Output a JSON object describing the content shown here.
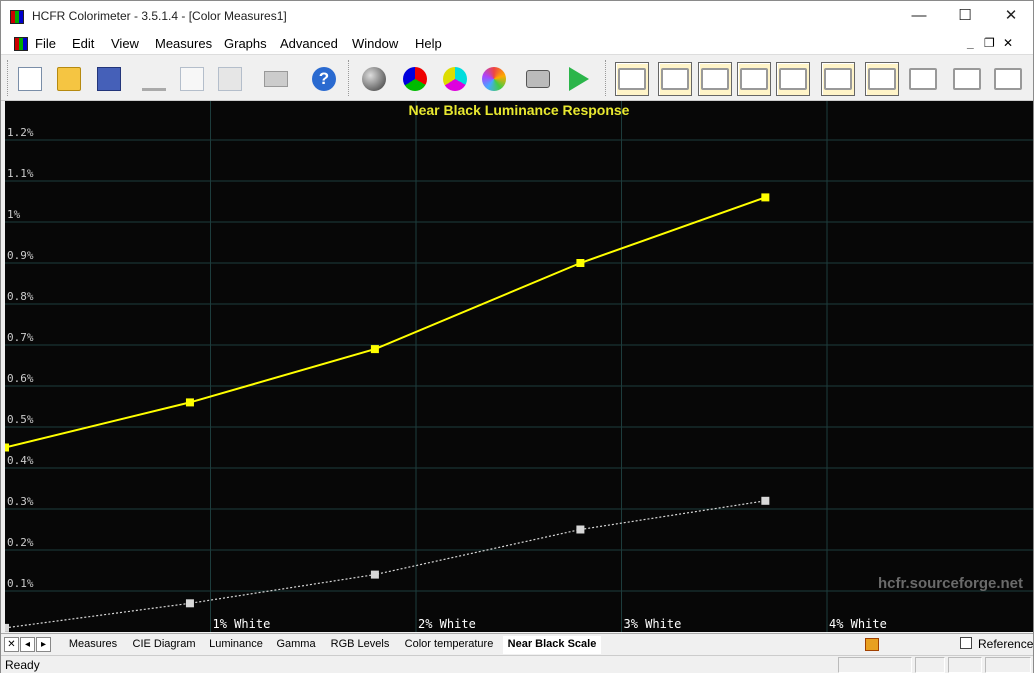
{
  "window": {
    "title": "HCFR Colorimeter - 3.5.1.4 - [Color Measures1]",
    "minimize": "—",
    "maximize": "☐",
    "close": "✕"
  },
  "menu": {
    "items": [
      "File",
      "Edit",
      "View",
      "Measures",
      "Graphs",
      "Advanced",
      "Window",
      "Help"
    ],
    "mdi_min": "_",
    "mdi_restore": "❐",
    "mdi_close": "✕"
  },
  "toolbar": {
    "icons": [
      "new-file-icon",
      "open-folder-icon",
      "save-icon",
      "cut-icon",
      "copy-icon",
      "paste-icon",
      "print-icon",
      "help-icon",
      "measure-grayscale-icon",
      "measure-primaries-icon",
      "measure-secondaries-icon",
      "measure-saturations-icon",
      "camera-icon",
      "play-icon",
      "graph-measures-icon",
      "graph-gamma-icon",
      "graph-luminance-icon",
      "graph-rgb-icon",
      "graph-colortemp-icon",
      "graph-cie-icon",
      "graph-nearblack-icon",
      "graph-nearwhite-icon",
      "graph-saturation-icon",
      "graph-sat-luminance-icon",
      "graph-sat-shift-icon"
    ],
    "help_glyph": "?"
  },
  "chart_data": {
    "type": "line",
    "title": "Near Black Luminance Response",
    "x": [
      0,
      0.9,
      1.8,
      2.8,
      3.7
    ],
    "x_ticks": [
      {
        "value": 1,
        "label": "1% White"
      },
      {
        "value": 2,
        "label": "2% White"
      },
      {
        "value": 3,
        "label": "3% White"
      },
      {
        "value": 4,
        "label": "4% White"
      }
    ],
    "xlim": [
      0,
      5
    ],
    "ylim": [
      0,
      1.3
    ],
    "y_ticks": [
      {
        "value": 0.1,
        "label": "0.1%"
      },
      {
        "value": 0.2,
        "label": "0.2%"
      },
      {
        "value": 0.3,
        "label": "0.3%"
      },
      {
        "value": 0.4,
        "label": "0.4%"
      },
      {
        "value": 0.5,
        "label": "0.5%"
      },
      {
        "value": 0.6,
        "label": "0.6%"
      },
      {
        "value": 0.7,
        "label": "0.7%"
      },
      {
        "value": 0.8,
        "label": "0.8%"
      },
      {
        "value": 0.9,
        "label": "0.9%"
      },
      {
        "value": 1.0,
        "label": "1%"
      },
      {
        "value": 1.1,
        "label": "1.1%"
      },
      {
        "value": 1.2,
        "label": "1.2%"
      }
    ],
    "series": [
      {
        "color": "#ffff00",
        "style": "solid",
        "values": [
          0.45,
          0.56,
          0.69,
          0.9,
          1.06
        ]
      },
      {
        "color": "#d8d8d8",
        "style": "dotted",
        "values": [
          0.01,
          0.07,
          0.14,
          0.25,
          0.32
        ]
      }
    ],
    "grid": true,
    "watermark": "hcfr.sourceforge.net",
    "title_color": "#e8e830"
  },
  "tabs": {
    "items": [
      "Measures",
      "CIE Diagram",
      "Luminance",
      "Gamma",
      "RGB Levels",
      "Color temperature",
      "Near Black Scale"
    ],
    "active": "Near Black Scale",
    "reference_label": "Reference"
  },
  "status": {
    "text": "Ready"
  }
}
